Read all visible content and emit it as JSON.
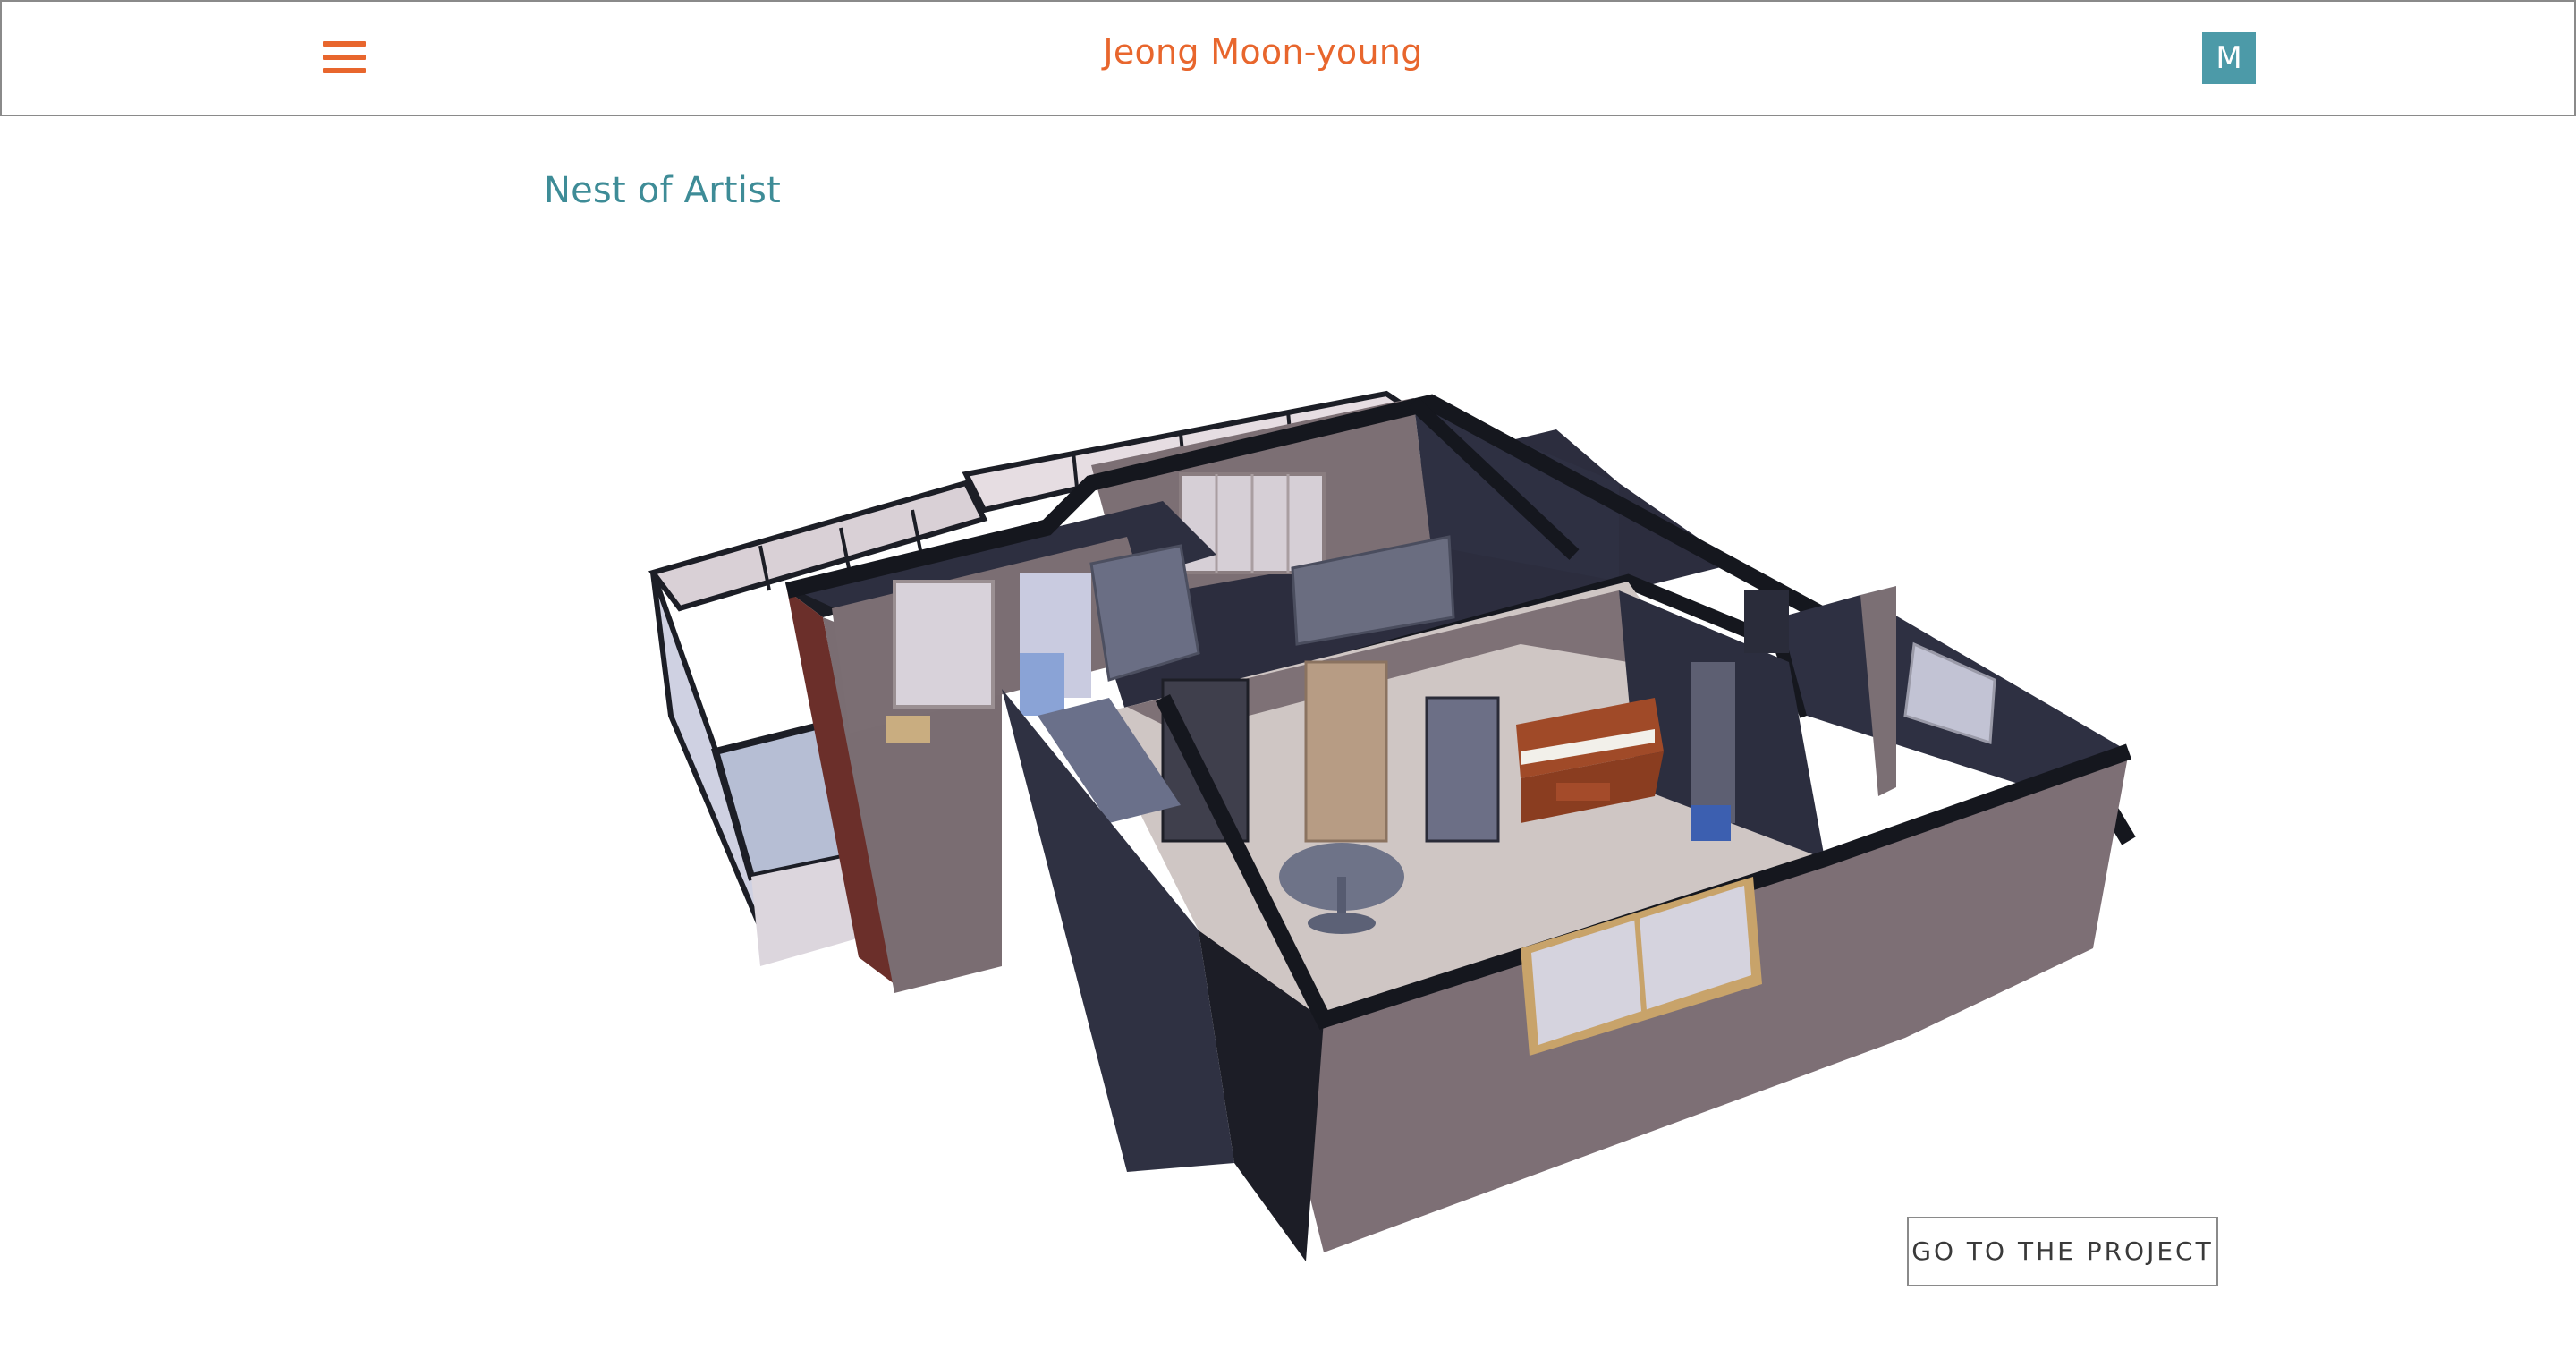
{
  "header": {
    "site_title": "Jeong Moon-young",
    "menu_icon": "hamburger-menu-icon",
    "avatar_letter": "M"
  },
  "project": {
    "title": "Nest of Artist",
    "image_alt": "3D floor plan model of apartment",
    "cta_label": "GO TO THE PROJECT"
  },
  "colors": {
    "accent_orange": "#e8662d",
    "accent_teal": "#4c9aa8",
    "title_teal": "#3e8c97"
  }
}
